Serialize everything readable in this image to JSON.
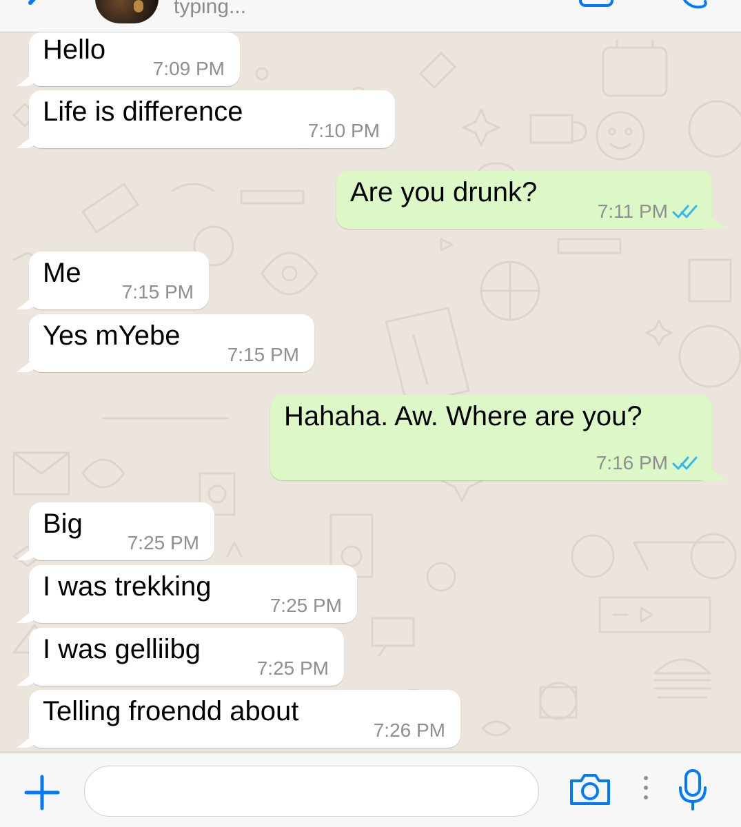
{
  "header": {
    "status": "typing...",
    "icons": {
      "back": "chevron-left-icon",
      "avatar": "contact-avatar",
      "video": "video-call-icon",
      "call": "phone-icon"
    }
  },
  "messages": [
    {
      "dir": "in",
      "text": "Hello",
      "time": "7:09 PM"
    },
    {
      "dir": "in",
      "text": "Life is difference",
      "time": "7:10 PM"
    },
    {
      "dir": "out",
      "text": "Are you drunk?",
      "time": "7:11 PM",
      "read": true
    },
    {
      "dir": "in",
      "text": "Me",
      "time": "7:15 PM"
    },
    {
      "dir": "in",
      "text": "Yes mYebe",
      "time": "7:15 PM"
    },
    {
      "dir": "out",
      "text": "Hahaha. Aw. Where are you?",
      "time": "7:16 PM",
      "read": true
    },
    {
      "dir": "in",
      "text": "Big",
      "time": "7:25 PM"
    },
    {
      "dir": "in",
      "text": "I was trekking",
      "time": "7:25 PM"
    },
    {
      "dir": "in",
      "text": "I was gelliibg",
      "time": "7:25 PM"
    },
    {
      "dir": "in",
      "text": "Telling froendd about",
      "time": "7:26 PM"
    }
  ],
  "input": {
    "value": "",
    "icons": {
      "add": "plus-icon",
      "camera": "camera-icon",
      "more": "more-vertical-icon",
      "mic": "microphone-icon"
    }
  },
  "colors": {
    "accent": "#007AFF",
    "outgoing_bubble": "#DCF8C6",
    "incoming_bubble": "#FFFFFF",
    "chat_background": "#ECE5DD",
    "read_ticks": "#34B7F1",
    "timestamp": "#8E8E93",
    "bar_background": "#F7F7F7"
  }
}
